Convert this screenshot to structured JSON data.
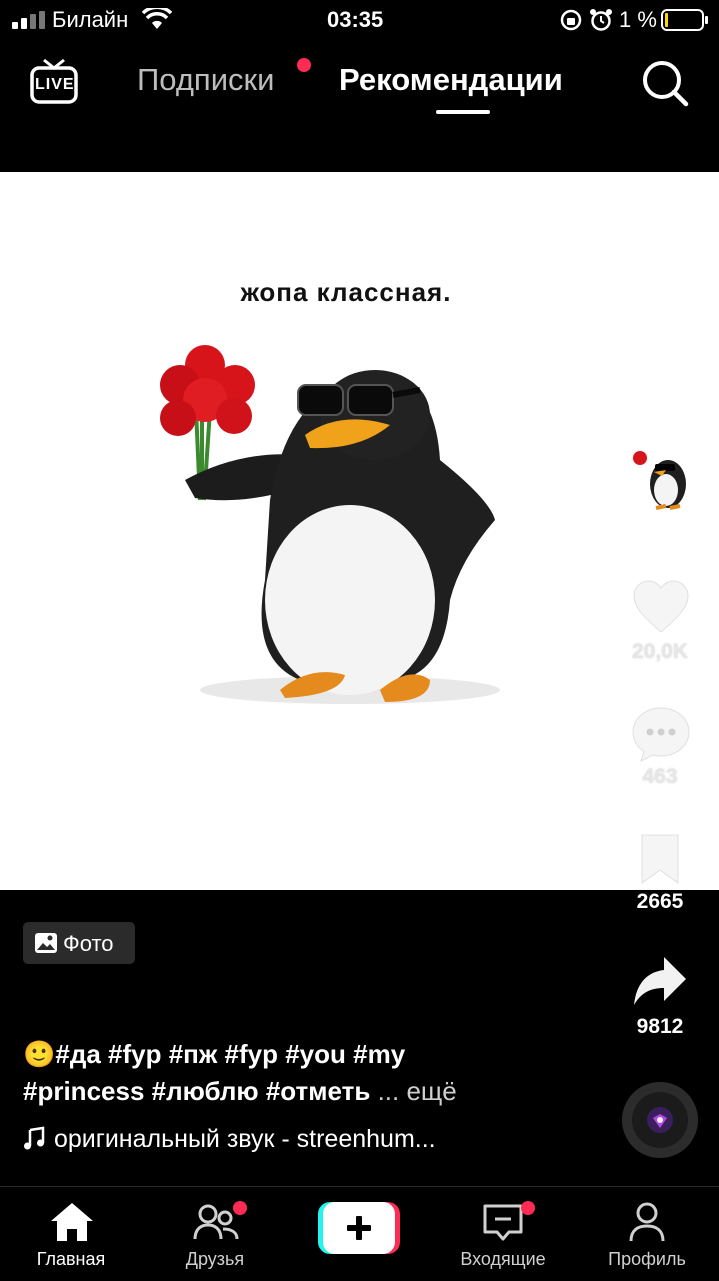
{
  "status_bar": {
    "carrier": "Билайн",
    "time": "03:35",
    "battery_percent": "1 %"
  },
  "top_nav": {
    "live_label": "LIVE",
    "tab_following": "Подписки",
    "tab_for_you": "Рекомендации"
  },
  "post": {
    "image_caption": "жопа классная.",
    "likes": "20,0K",
    "comments": "463",
    "bookmarks": "2665",
    "shares": "9812",
    "media_type_badge": "Фото",
    "description_line1": "🙂#да #fyp #пж #fyp #you #my",
    "description_line2": "#princess #люблю #отметь",
    "more_label": "... ещё",
    "sound": "оригинальный звук - streenhum..."
  },
  "bottom_nav": {
    "home": "Главная",
    "friends": "Друзья",
    "inbox": "Входящие",
    "profile": "Профиль"
  },
  "colors": {
    "accent_red": "#fe2c55",
    "accent_cyan": "#25f4ee",
    "background": "#000000"
  }
}
